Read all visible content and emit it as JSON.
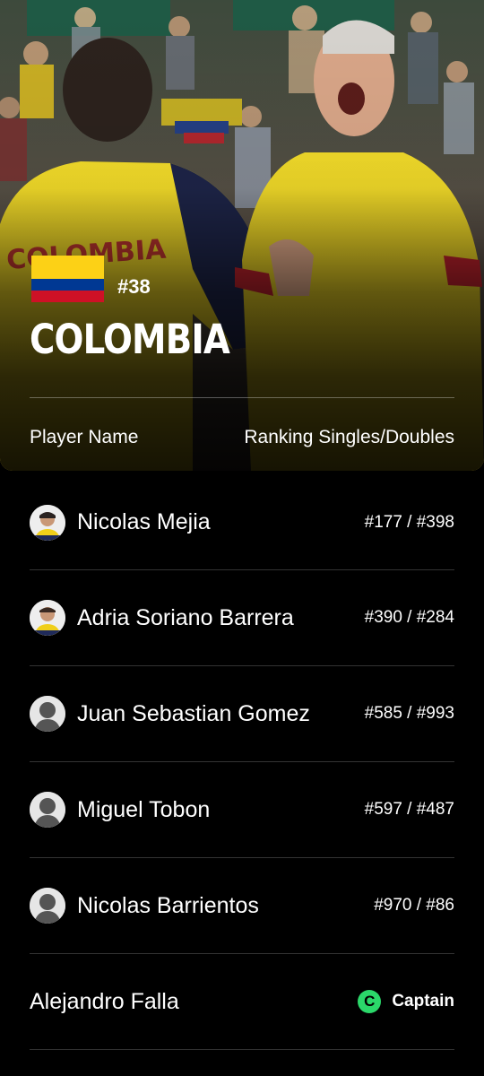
{
  "team": {
    "rank": "#38",
    "name": "COLOMBIA",
    "flag_colors": [
      "#FCD116",
      "#003893",
      "#CE1126"
    ]
  },
  "columns": {
    "player": "Player Name",
    "ranking": "Ranking Singles/Doubles"
  },
  "players": [
    {
      "name": "Nicolas Mejia",
      "ranking": "#177 / #398",
      "avatar": "player-photo"
    },
    {
      "name": "Adria Soriano Barrera",
      "ranking": "#390 / #284",
      "avatar": "player-photo"
    },
    {
      "name": "Juan Sebastian Gomez",
      "ranking": "#585 / #993",
      "avatar": "placeholder-silhouette"
    },
    {
      "name": "Miguel Tobon",
      "ranking": "#597 / #487",
      "avatar": "placeholder-silhouette"
    },
    {
      "name": "Nicolas Barrientos",
      "ranking": "#970 / #86",
      "avatar": "placeholder-silhouette"
    }
  ],
  "captain": {
    "name": "Alejandro Falla",
    "badge_letter": "C",
    "badge_label": "Captain",
    "badge_color": "#2BD86A"
  }
}
